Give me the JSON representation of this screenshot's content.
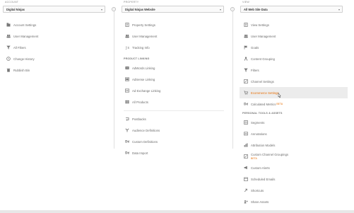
{
  "account": {
    "heading": "ACCOUNT",
    "selector": "Digital Ninjas",
    "items": [
      {
        "label": "Account Settings",
        "icon": "building-icon"
      },
      {
        "label": "User Management",
        "icon": "users-icon"
      },
      {
        "label": "All Filters",
        "icon": "filter-icon"
      },
      {
        "label": "Change History",
        "icon": "history-icon"
      },
      {
        "label": "Rubbish Bin",
        "icon": "trash-icon"
      }
    ]
  },
  "property": {
    "heading": "PROPERTY",
    "selector": "Digital Ninjas Website",
    "items": [
      {
        "label": "Property Settings",
        "icon": "document-icon"
      },
      {
        "label": "User Management",
        "icon": "users-icon"
      },
      {
        "label": "Tracking Info",
        "icon": "code-icon"
      }
    ],
    "product_linking_heading": "PRODUCT LINKING",
    "product_linking": [
      {
        "label": "AdWords Linking",
        "icon": "adwords-icon"
      },
      {
        "label": "AdSense Linking",
        "icon": "adsense-icon"
      },
      {
        "label": "Ad Exchange Linking",
        "icon": "ad-exchange-icon"
      },
      {
        "label": "All Products",
        "icon": "grid-icon"
      }
    ],
    "more": [
      {
        "label": "Postbacks",
        "icon": "postback-icon"
      },
      {
        "label": "Audience Definitions",
        "icon": "audience-icon"
      },
      {
        "label": "Custom Definitions",
        "icon": "dd-icon"
      },
      {
        "label": "Data Import",
        "icon": "dd-icon"
      }
    ]
  },
  "view": {
    "heading": "VIEW",
    "selector": "All Web Site Data",
    "items": [
      {
        "label": "View Settings",
        "icon": "document-icon"
      },
      {
        "label": "User Management",
        "icon": "users-icon"
      },
      {
        "label": "Goals",
        "icon": "flag-icon"
      },
      {
        "label": "Content Grouping",
        "icon": "person-icon"
      },
      {
        "label": "Filters",
        "icon": "filter-icon"
      },
      {
        "label": "Channel Settings",
        "icon": "channel-icon"
      },
      {
        "label": "Ecommerce Settings",
        "icon": "cart-icon",
        "active": true
      },
      {
        "label": "Calculated Metrics",
        "icon": "dd-icon",
        "badge": "BETA"
      }
    ],
    "personal_heading": "PERSONAL TOOLS & ASSETS",
    "personal": [
      {
        "label": "Segments",
        "icon": "segments-icon"
      },
      {
        "label": "Annotations",
        "icon": "annotation-icon"
      },
      {
        "label": "Attribution Models",
        "icon": "bar-chart-icon"
      },
      {
        "label": "Custom Channel Groupings",
        "icon": "channel-icon",
        "sub": "BETA"
      },
      {
        "label": "Custom Alerts",
        "icon": "megaphone-icon"
      },
      {
        "label": "Scheduled Emails",
        "icon": "calendar-icon"
      },
      {
        "label": "Shortcuts",
        "icon": "shortcut-icon"
      },
      {
        "label": "Share Assets",
        "icon": "share-icon"
      }
    ]
  },
  "colors": {
    "active_text": "#e8710a",
    "active_bg": "#ececec",
    "text": "#6b6b6b",
    "heading": "#8a8a8a"
  }
}
